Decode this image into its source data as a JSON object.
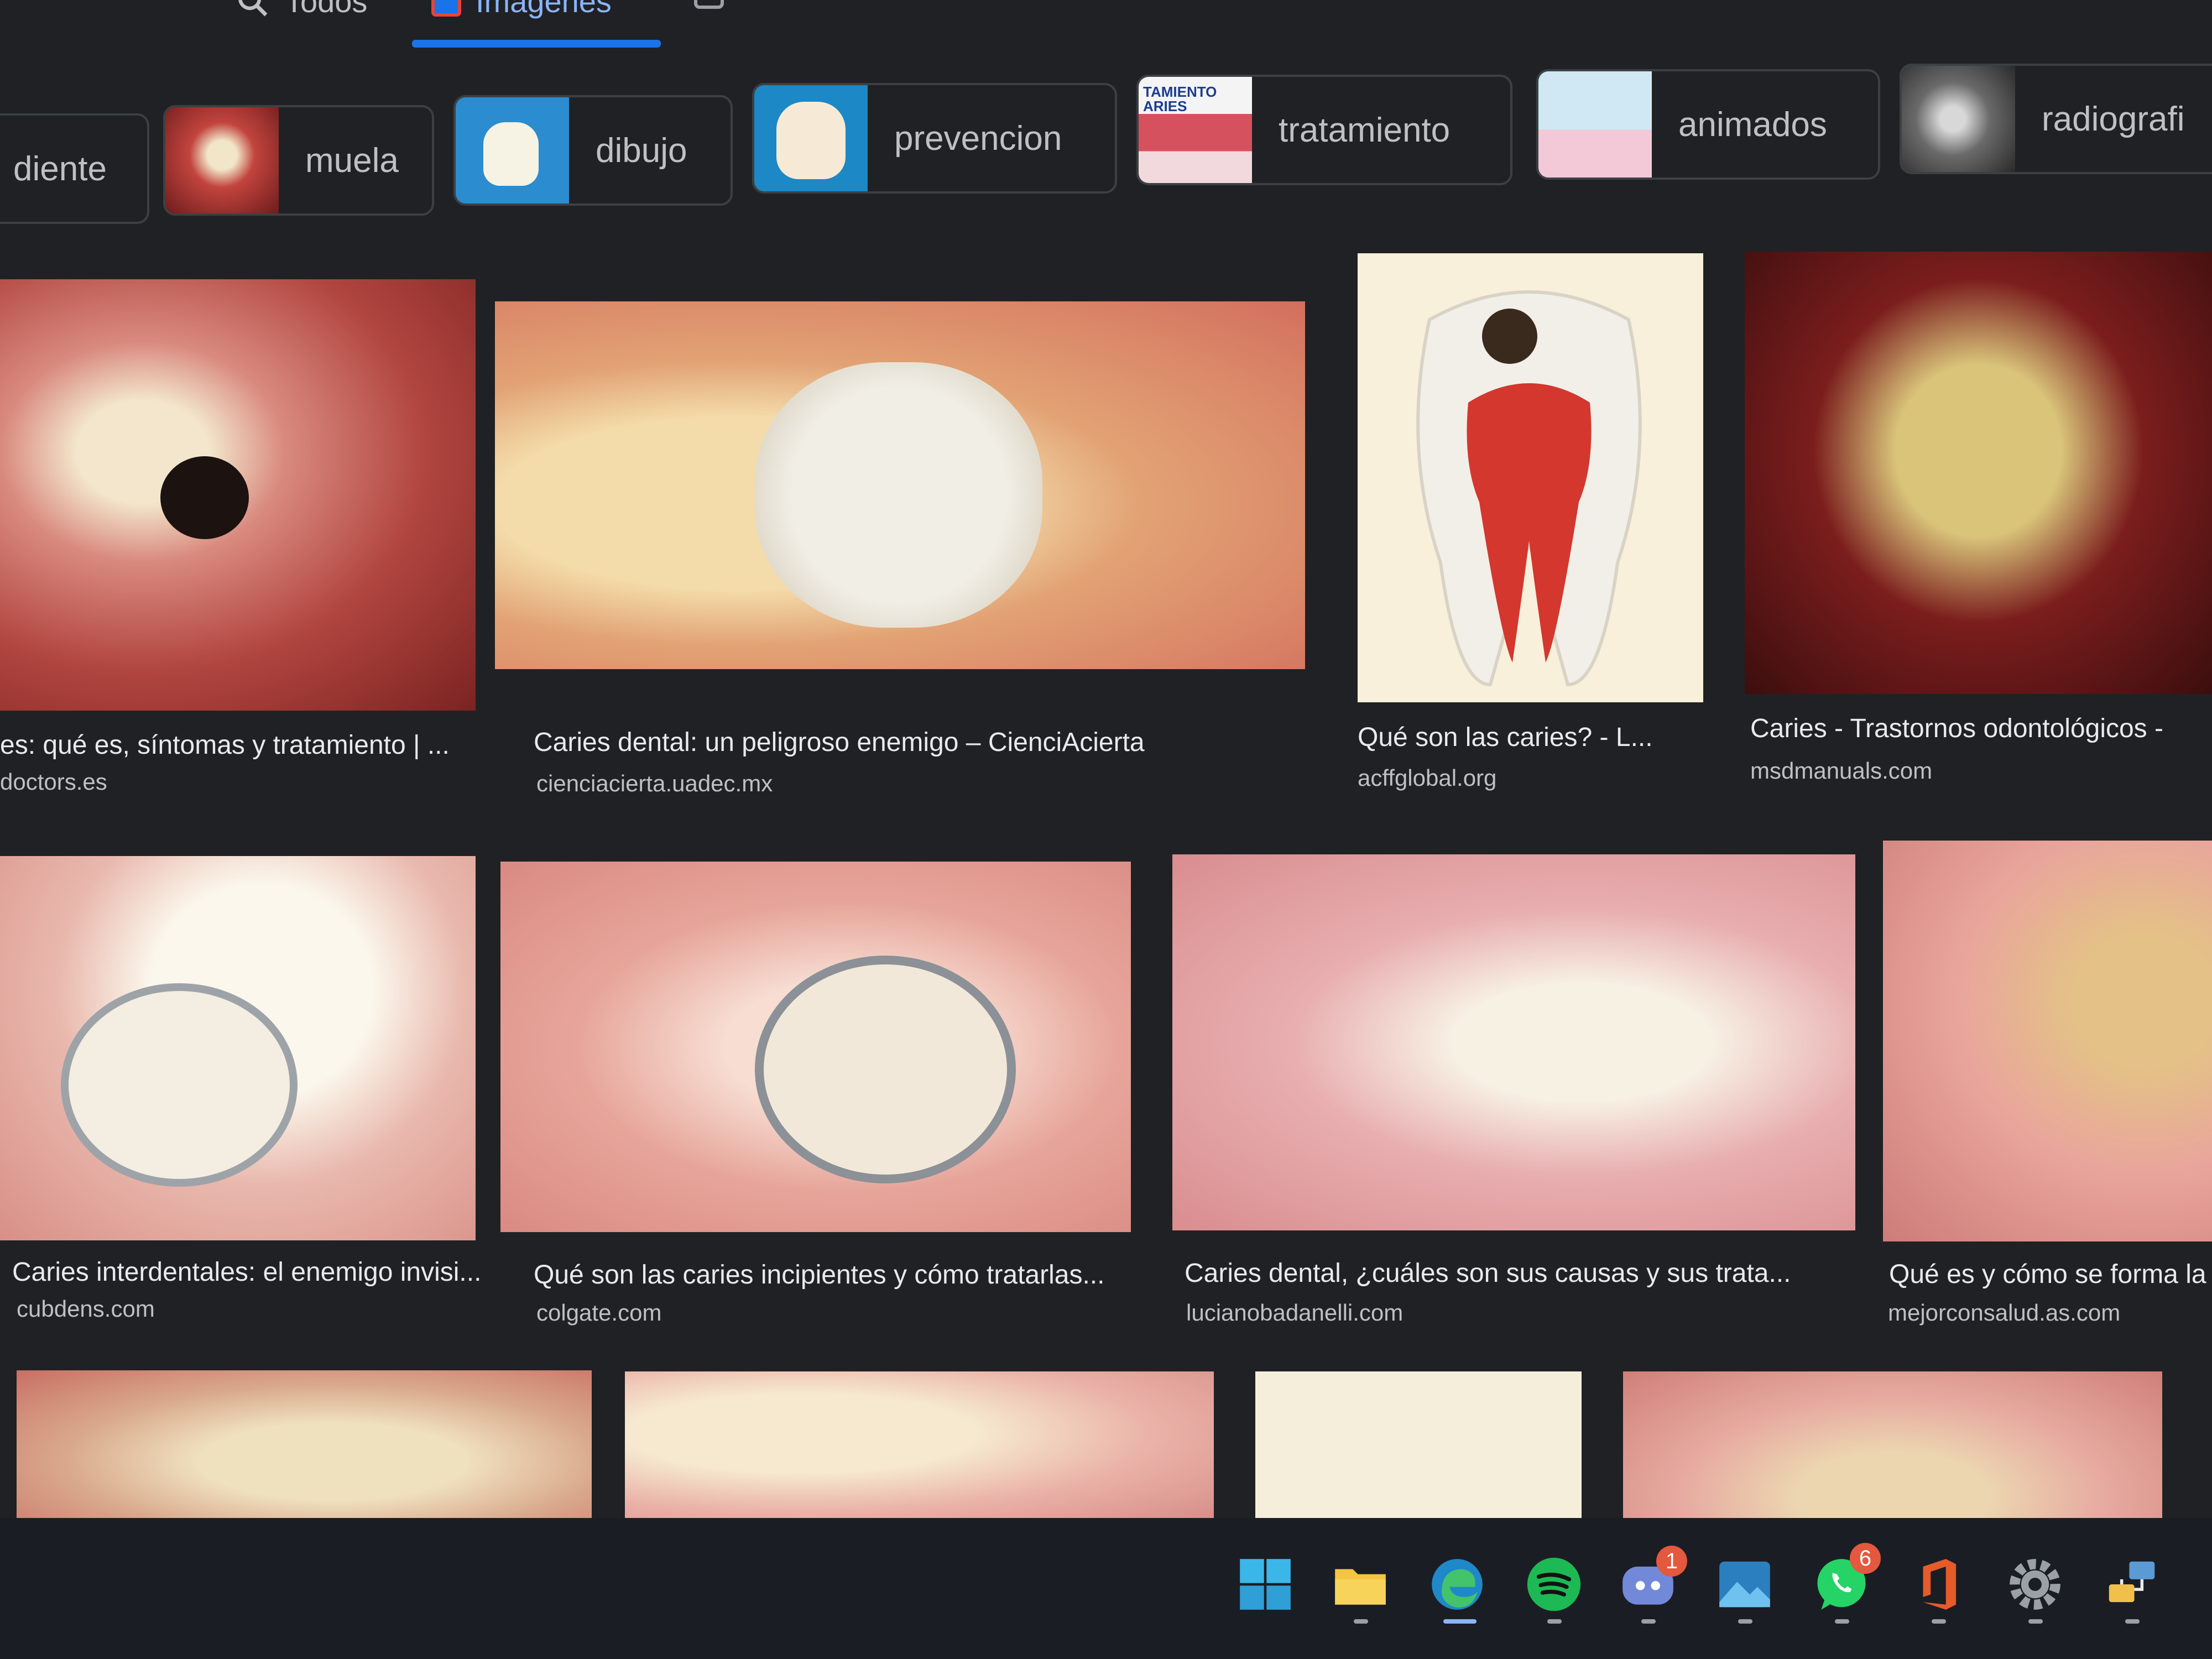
{
  "tabs": [
    {
      "label": "Todos",
      "icon": "search-icon"
    },
    {
      "label": "Imágenes",
      "icon": "image-icon"
    }
  ],
  "chips": [
    {
      "label": "diente"
    },
    {
      "label": "muela"
    },
    {
      "label": "dibujo"
    },
    {
      "label": "prevencion"
    },
    {
      "label": "tratamiento",
      "thumb_text": "TAMIENTO ARIES"
    },
    {
      "label": "animados"
    },
    {
      "label": "radiografi"
    }
  ],
  "results": [
    {
      "title": "es: qué es, síntomas y tratamiento | ...",
      "site": "doctors.es"
    },
    {
      "title": "Caries dental: un peligroso enemigo – CienciAcierta",
      "site": "cienciacierta.uadec.mx"
    },
    {
      "title": "Qué son las caries? - L...",
      "site": "acffglobal.org"
    },
    {
      "title": "Caries - Trastornos odontológicos -",
      "site": "msdmanuals.com"
    },
    {
      "title": "Caries interdentales: el enemigo invisi...",
      "site": "cubdens.com"
    },
    {
      "title": "Qué son las caries incipientes y cómo tratarlas...",
      "site": "colgate.com"
    },
    {
      "title": "Caries dental, ¿cuáles son sus causas y sus trata...",
      "site": "lucianobadanelli.com"
    },
    {
      "title": "Qué es y cómo se forma la",
      "site": "mejorconsalud.as.com"
    }
  ],
  "taskbar": {
    "icons": [
      "windows-start-icon",
      "file-explorer-icon",
      "edge-icon",
      "spotify-icon",
      "discord-icon",
      "photos-icon",
      "whatsapp-icon",
      "office-icon",
      "settings-icon",
      "network-icon"
    ],
    "discord_badge": "1",
    "whatsapp_badge": "6"
  },
  "colors": {
    "background": "#202124",
    "accent": "#1a73e8",
    "chip_border": "#3c4043"
  }
}
